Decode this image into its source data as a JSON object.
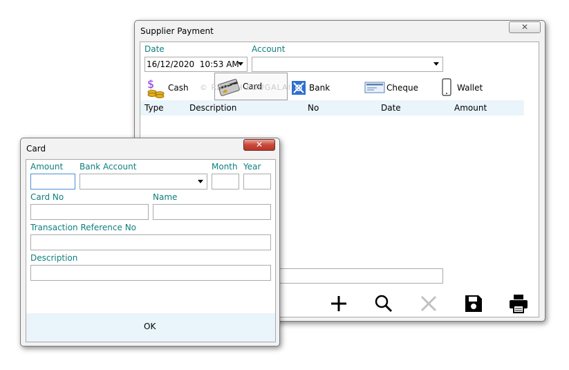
{
  "main_window": {
    "title": "Supplier Payment",
    "close_label": "✕",
    "date_label": "Date",
    "date_value": "16/12/2020  10:53 AM",
    "account_label": "Account",
    "account_value": "",
    "payment_types": [
      {
        "label": "Cash",
        "icon": "cash-icon"
      },
      {
        "label": "Card",
        "icon": "card-icon"
      },
      {
        "label": "Bank",
        "icon": "bank-icon"
      },
      {
        "label": "Cheque",
        "icon": "cheque-icon"
      },
      {
        "label": "Wallet",
        "icon": "wallet-icon"
      }
    ],
    "watermark": "© RAJESH EDUGALAI",
    "grid_columns": [
      "Type",
      "Description",
      "No",
      "Date",
      "Amount"
    ],
    "toolbar": [
      "add-icon",
      "search-icon",
      "delete-icon",
      "save-icon",
      "print-icon"
    ]
  },
  "card_dialog": {
    "title": "Card",
    "close_label": "✕",
    "amount_label": "Amount",
    "bank_account_label": "Bank Account",
    "month_label": "Month",
    "year_label": "Year",
    "card_no_label": "Card No",
    "name_label": "Name",
    "transaction_ref_label": "Transaction Reference No",
    "description_label": "Description",
    "ok_label": "OK"
  },
  "colors": {
    "label": "#0e7e7e",
    "grid_header": "#eaf4fb",
    "footer": "#e9f4fb",
    "focus_border": "#4a8fd6"
  }
}
